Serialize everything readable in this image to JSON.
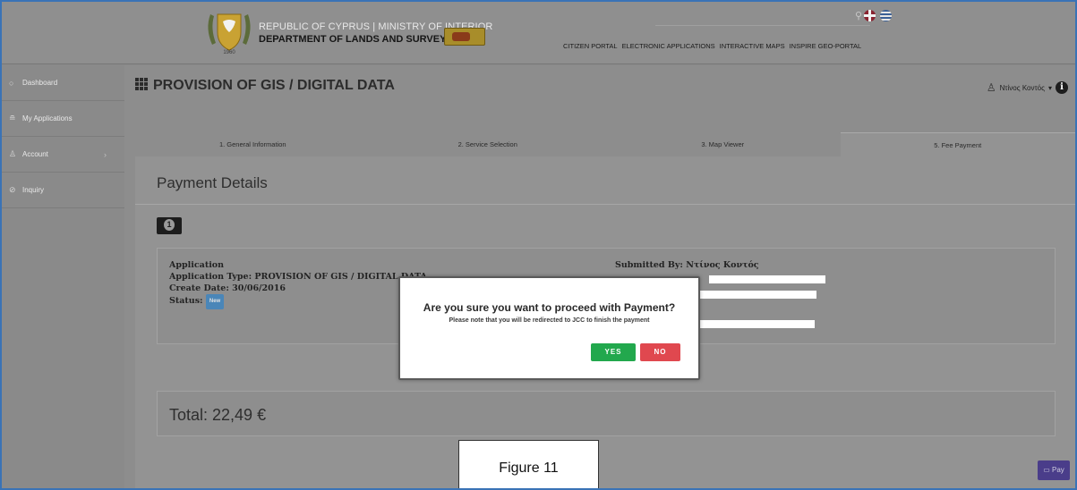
{
  "header": {
    "line1": "REPUBLIC OF CYPRUS | MINISTRY OF INTERIOR",
    "line2": "DEPARTMENT OF LANDS AND SURVEYS",
    "search_icon": "search-icon",
    "nav": [
      "CITIZEN PORTAL",
      "ELECTRONIC APPLICATIONS",
      "INTERACTIVE MAPS",
      "INSPIRE GEO-PORTAL"
    ]
  },
  "sidebar": {
    "items": [
      {
        "label": "Dashboard",
        "icon": "○"
      },
      {
        "label": "My Applications",
        "icon": "≘"
      },
      {
        "label": "Account",
        "icon": "♙",
        "chevron": "›"
      },
      {
        "label": "Inquiry",
        "icon": "⊘"
      }
    ]
  },
  "main": {
    "title": "PROVISION OF GIS / DIGITAL DATA",
    "user_name": "Ντίνος Κοντός",
    "user_caret": "▾",
    "info_icon": "i",
    "tabs": [
      {
        "label": "1. General Information"
      },
      {
        "label": "2. Service Selection"
      },
      {
        "label": "3. Map Viewer"
      },
      {
        "label": "5. Fee Payment"
      }
    ],
    "panel_title": "Payment Details",
    "application": {
      "heading": "Application",
      "type": "Application Type: PROVISION OF GIS / DIGITAL DATA",
      "create_date": "Create Date: 30/06/2016",
      "status_label": "Status:",
      "status_value": "New",
      "submitted_by": "Submitted By: Ντίνος Κοντός"
    },
    "total": "Total: 22,49 €",
    "pay_label": "Pay",
    "pay_icon": "▭"
  },
  "dialog": {
    "title": "Are you sure you want to proceed with Payment?",
    "subtitle": "Please note that you will be redirected to JCC to finish the payment",
    "yes": "YES",
    "no": "NO"
  },
  "figure_label": "Figure 11",
  "colors": {
    "yes": "#22a84d",
    "no": "#e0484f",
    "pay": "#4a3d8a",
    "status_badge": "#4a86b8",
    "frame": "#3a73b6"
  }
}
